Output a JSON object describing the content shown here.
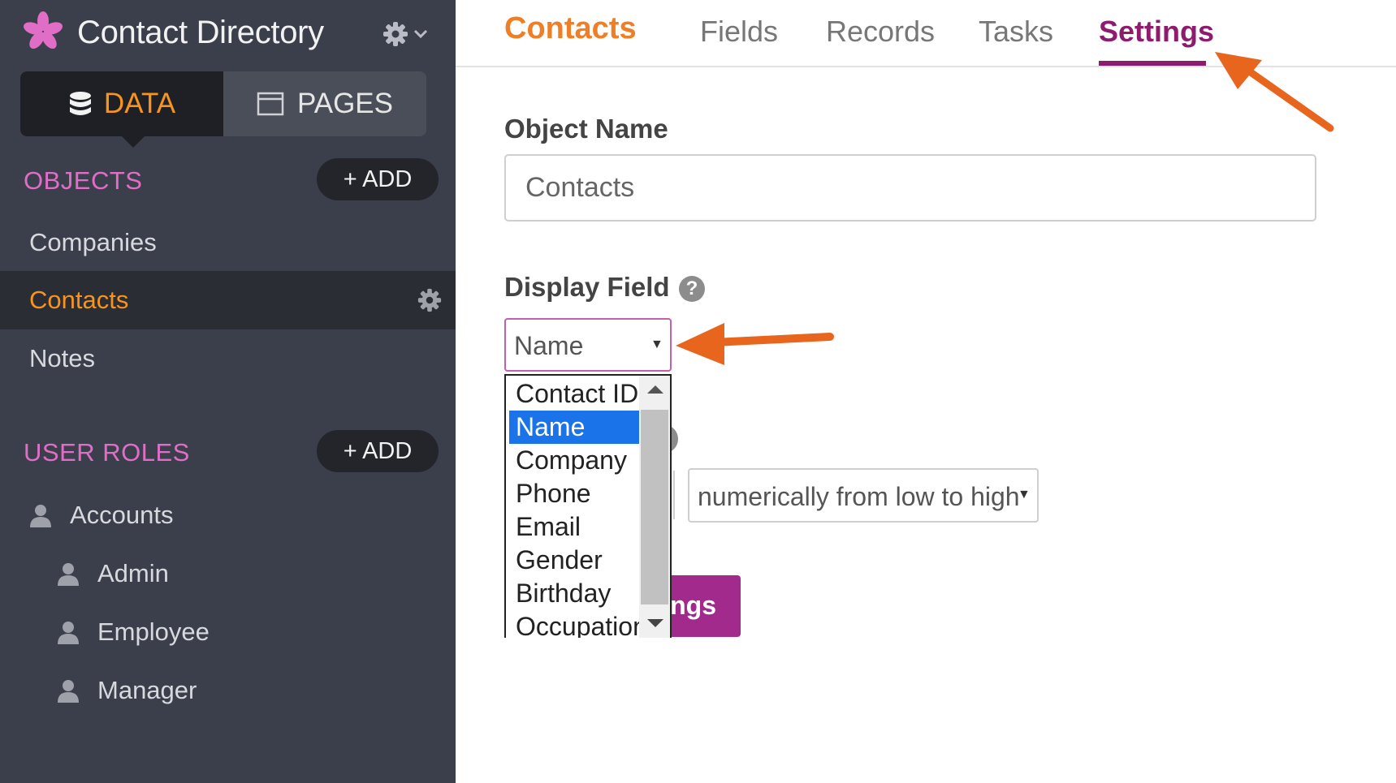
{
  "app": {
    "title": "Contact Directory",
    "logo_icon": "asterisk-logo-icon",
    "brand_color": "#e06ec7"
  },
  "mode_toggle": {
    "data_label": "DATA",
    "pages_label": "PAGES",
    "active": "DATA"
  },
  "objects": {
    "header": "OBJECTS",
    "add_label": "+ ADD",
    "items": [
      {
        "label": "Companies"
      },
      {
        "label": "Contacts",
        "active": true
      },
      {
        "label": "Notes"
      }
    ]
  },
  "user_roles": {
    "header": "USER ROLES",
    "add_label": "+ ADD",
    "items": [
      {
        "label": "Accounts"
      },
      {
        "label": "Admin"
      },
      {
        "label": "Employee"
      },
      {
        "label": "Manager"
      }
    ]
  },
  "tabs": {
    "brand": "Contacts",
    "items": [
      "Fields",
      "Records",
      "Tasks",
      "Settings"
    ],
    "active": "Settings"
  },
  "settings": {
    "object_name_label": "Object Name",
    "object_name_value": "Contacts",
    "display_field_label": "Display Field",
    "display_field_value": "Name",
    "help_glyph": "?",
    "sort_value": "numerically from low to high",
    "save_button_visible_text": "ings"
  },
  "dropdown": {
    "options": [
      "Contact ID",
      "Name",
      "Company",
      "Phone",
      "Email",
      "Gender",
      "Birthday",
      "Occupation"
    ],
    "selected": "Name"
  },
  "colors": {
    "sidebar_bg": "#3b3f4b",
    "accent_orange": "#f7941d",
    "tab_active": "#8e1b6e",
    "annotation_arrow": "#e8651e"
  }
}
